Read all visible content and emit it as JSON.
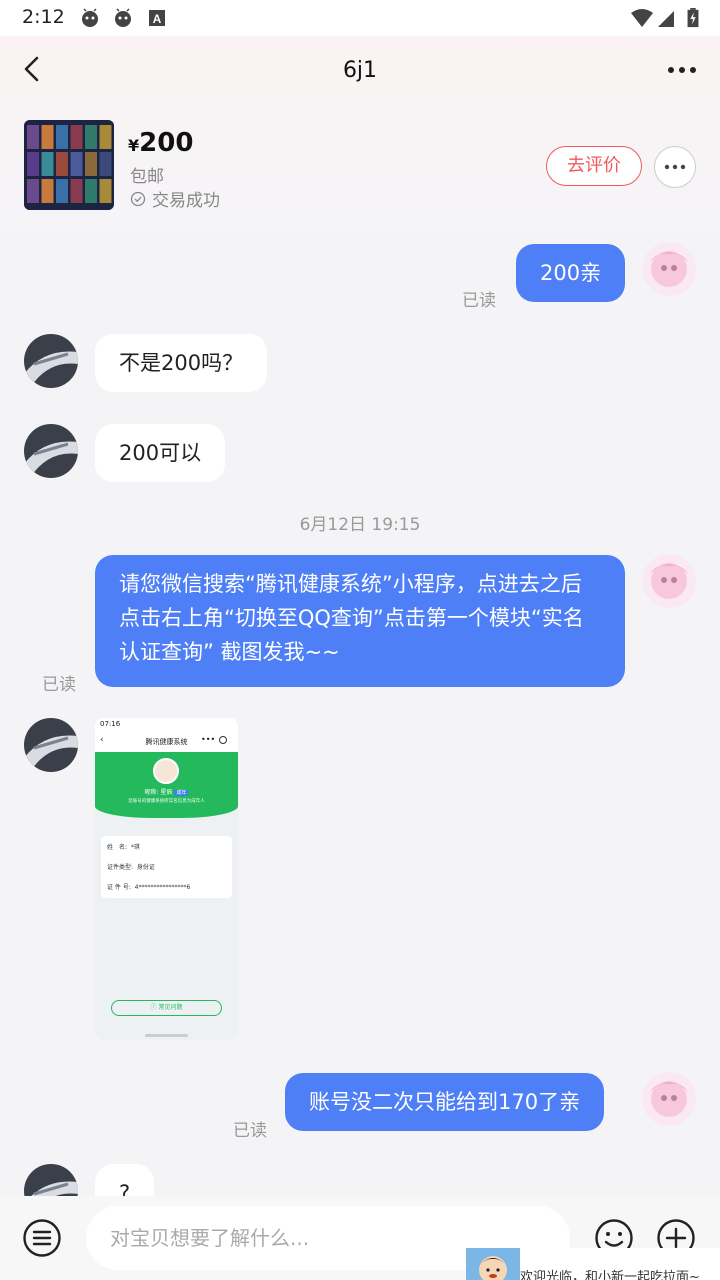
{
  "status_bar": {
    "time": "2:12",
    "icons": [
      "app-notification-icon",
      "app-notification-icon",
      "text-a-icon",
      "wifi-icon",
      "signal-icon",
      "battery-icon"
    ]
  },
  "header": {
    "title": "6j1",
    "product": {
      "currency": "¥",
      "price": "200",
      "shipping": "包邮",
      "status": "交易成功",
      "review_label": "去评价"
    }
  },
  "messages": [
    {
      "from": "me",
      "text": "200亲",
      "read": "已读"
    },
    {
      "from": "other",
      "text": "不是200吗？"
    },
    {
      "from": "other",
      "text": "200可以"
    },
    {
      "type": "timestamp",
      "text": "6月12日 19:15"
    },
    {
      "from": "me",
      "text": "请您微信搜索“腾讯健康系统”小程序，点进去之后点击右上角“切换至QQ查询”点击第一个模块“实名认证查询” 截图发我~~",
      "read": "已读"
    },
    {
      "from": "other",
      "type": "image",
      "image": {
        "time": "07:16",
        "title": "腾讯健康系统",
        "nickname_label": "昵称:",
        "nickname": "星辰",
        "tag": "成年",
        "notice": "您账号的健康系统所实名信息为成年人",
        "fields": [
          {
            "label": "姓　名:",
            "value": "*琪"
          },
          {
            "label": "证件类型:",
            "value": "身份证"
          },
          {
            "label": "证 件 号:",
            "value": "4****************6"
          }
        ],
        "help": "常见问题"
      }
    },
    {
      "from": "me",
      "text": "账号没二次只能给到170了亲",
      "read": "已读"
    },
    {
      "from": "other",
      "text": "?"
    }
  ],
  "input": {
    "placeholder": "对宝贝想要了解什么..."
  },
  "banner": {
    "text": "欢迎光临，和小新一起吃拉面~"
  },
  "colors": {
    "accent": "#4f7ff7",
    "review": "#f05a5a",
    "background": "#f4f4f6"
  }
}
